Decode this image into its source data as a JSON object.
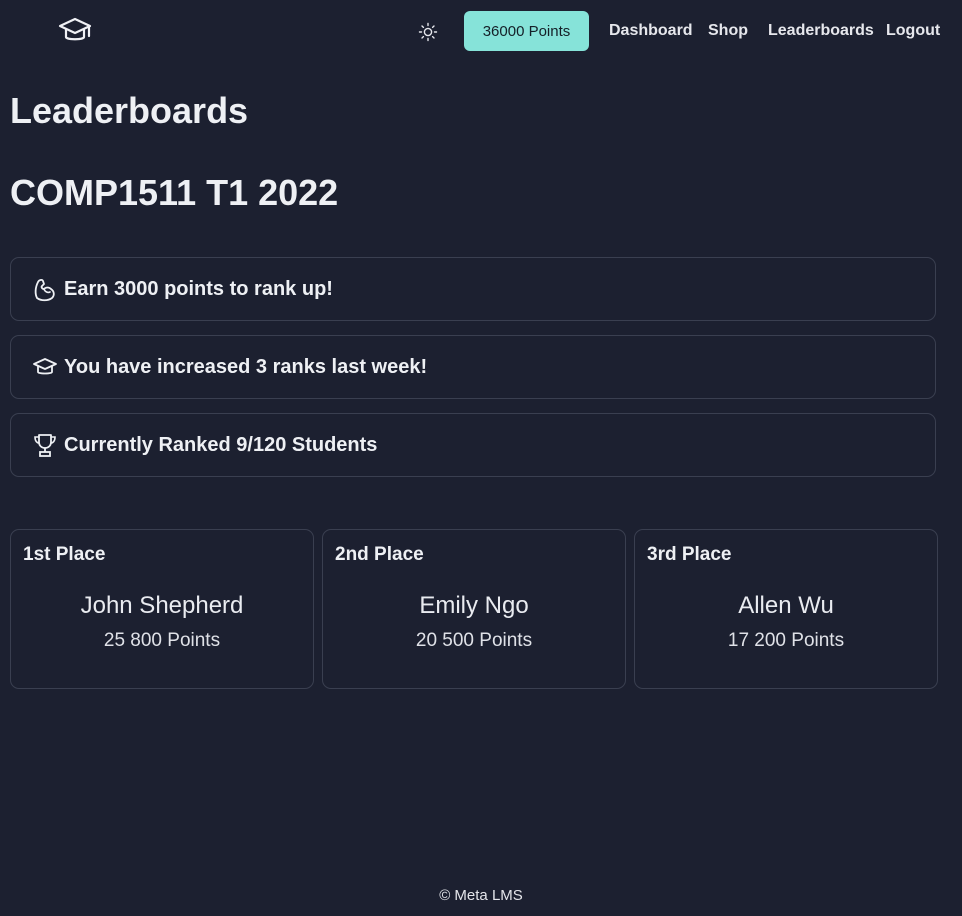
{
  "navbar": {
    "logo_icon": "graduation-cap-icon",
    "theme_icon": "sun-icon",
    "points_label": "36000 Points",
    "links": {
      "dashboard": "Dashboard",
      "shop": "Shop",
      "leaderboards": "Leaderboards",
      "logout": "Logout"
    },
    "accent_color": "#86e3d9"
  },
  "main": {
    "page_title": "Leaderboards",
    "course_title": "COMP1511 T1 2022",
    "info_cards": [
      {
        "icon": "flexed-bicep-icon",
        "text": "Earn 3000 points to rank up!"
      },
      {
        "icon": "graduation-cap-icon",
        "text": "You have increased 3 ranks last week!"
      },
      {
        "icon": "trophy-icon",
        "text": "Currently Ranked 9/120 Students"
      }
    ],
    "podium": [
      {
        "place": "1st Place",
        "name": "John Shepherd",
        "points": "25 800 Points"
      },
      {
        "place": "2nd Place",
        "name": "Emily Ngo",
        "points": "20 500 Points"
      },
      {
        "place": "3rd Place",
        "name": "Allen Wu",
        "points": "17 200 Points"
      }
    ]
  },
  "footer": {
    "text": "© Meta LMS"
  }
}
